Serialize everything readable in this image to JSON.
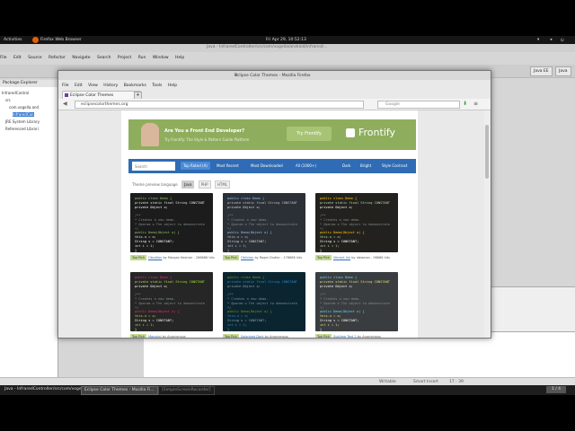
{
  "top_bar": {
    "activities": "Activities",
    "app": "Firefox Web Browser",
    "clock": "Fri Apr 29, 10:52:13"
  },
  "eclipse": {
    "title": "Java - InfraredController/src/com/vogella/android/infrared/...",
    "menu": [
      "File",
      "Edit",
      "Source",
      "Refactor",
      "Navigate",
      "Search",
      "Project",
      "Run",
      "Window",
      "Help"
    ],
    "package_explorer": "Package Explorer",
    "tree": [
      "InfraredControl",
      "src",
      "com.vogella.and",
      "InfraredCon",
      "JRE System Library",
      "Referenced Librari"
    ],
    "perspectives": [
      "Java EE",
      "Java"
    ],
    "status": [
      "Writable",
      "Smart Insert",
      "17 : 39"
    ]
  },
  "firefox": {
    "title": "Eclipse Color Themes - Mozilla Firefox",
    "menu": [
      "File",
      "Edit",
      "View",
      "History",
      "Bookmarks",
      "Tools",
      "Help"
    ],
    "tab": "Eclipse Color Themes",
    "new_tab": "+",
    "close": "✕",
    "url": "eclipsecolorthemes.org",
    "search_placeholder": "Google"
  },
  "page": {
    "banner": {
      "headline": "Are You a Front End Developer?",
      "sub": "Try Frontify: The Style & Pattern Guide Platform",
      "cta": "Try Frontify",
      "brand": "Frontify"
    },
    "nav": {
      "search_placeholder": "Search",
      "links": [
        "Top Rated (A)",
        "Most Recent",
        "Most Downloaded",
        "All (1000+)",
        "Dark",
        "Bright",
        "Style Contrast"
      ]
    },
    "filters": {
      "label": "Theme preview language",
      "options": [
        "Java",
        "PHP",
        "HTML"
      ]
    },
    "cards": [
      {
        "bg": "#1c1c1c",
        "tag": "Top Pick",
        "name": "Obsidian",
        "by": "by Morgan Kestner - 266666 hits"
      },
      {
        "bg": "#2b2f36",
        "tag": "Top Pick",
        "name": "Oblivion",
        "by": "by Roger Dudler - 176666 hits"
      },
      {
        "bg": "#23211e",
        "tag": "Top Pick",
        "name": "Vibrant Ink",
        "by": "by ideaman - 96666 hits"
      },
      {
        "bg": "#262626",
        "tag": "Top Pick",
        "name": "Monokai",
        "by": "by Anonymous"
      },
      {
        "bg": "#0b2530",
        "tag": "Top Pick",
        "name": "Solarized Dark",
        "by": "by Anonymous"
      },
      {
        "bg": "#3a3d40",
        "tag": "Top Pick",
        "name": "Sublime Text 2",
        "by": "by Anonymous"
      }
    ],
    "code_lines": [
      "public class Demo {",
      "  private static final String CONSTANT",
      "  private Object o;",
      "",
      "  /**",
      "   * Creates a new demo.",
      "   * @param o The object to demonstrate",
      "   */",
      "  public Demo(Object o) {",
      "    this.o = o;",
      "    String s = CONSTANT;",
      "    int i = 1;",
      "  }"
    ]
  },
  "taskbar": {
    "items": [
      "Java - InfraredController/src/com/vogel...",
      "Eclipse Color Themes - Mozilla Fi...",
      "[SimpleScreenRecorder]"
    ],
    "pager": "1 / 4"
  }
}
